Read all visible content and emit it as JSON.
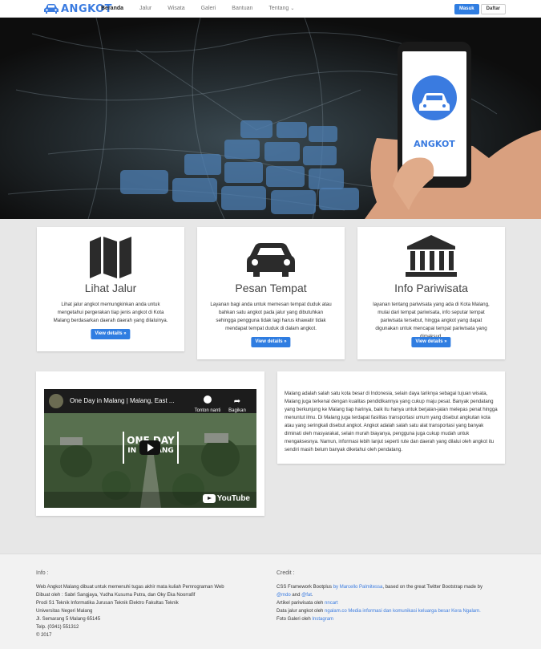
{
  "navbar": {
    "brand": "ANGKOT",
    "links": [
      "Beranda",
      "Jalur",
      "Wisata",
      "Galeri",
      "Bantuan",
      "Tentang"
    ],
    "active": "Beranda",
    "login": "Masuk",
    "register": "Daftar"
  },
  "hero": {
    "phone_brand": "ANGKOT"
  },
  "features": [
    {
      "icon": "map-icon",
      "title": "Lihat Jalur",
      "text": "Lihat jalur angkot memungkinkan anda untuk mengetahui pergerakan tiap jenis angkot di Kota Malang berdasarkan daerah daerah yang dilaluinya.",
      "button": "View details »"
    },
    {
      "icon": "car-icon",
      "title": "Pesan Tempat",
      "text": "Layanan bagi anda untuk memesan tempat duduk atau bahkan satu angkot pada jalur yang dibutuhkan sehingga pengguna tidak lagi harus khawatir tidak mendapat tempat duduk di dalam angkot.",
      "button": "View details »"
    },
    {
      "icon": "bank-icon",
      "title": "Info Pariwisata",
      "text": "layanan tentang pariwisata yang ada di Kota Malang, mulai dari tempat pariwisata, info seputar tempat pariwisata tersebut, hingga angkot yang dapat digunakan untuk mencapai tempat pariwisata yang dimaksud.",
      "button": "View details »"
    }
  ],
  "video": {
    "title": "One Day in Malang | Malang, East ...",
    "watch_later": "Tonton nanti",
    "share": "Bagikan",
    "overlay_line1": "ONE DAY",
    "overlay_line2": "IN MALANG",
    "youtube": "YouTube"
  },
  "about_text": "Malang adalah salah satu kota besar di Indonesia, selain daya tariknya sebagai tujuan wisata, Malang juga terkenal dengan kualitas pendidikannya yang cukup maju pesat. Banyak pendatang yang berkunjung ke Malang tiap harinya, baik itu hanya untuk berjalan-jalan melepas penat hingga menuntut ilmu. Di Malang juga terdapat fasilitas transportasi umum yang disebut angkutan kota atau yang seringkali disebut angkot. Angkot adalah salah satu alat transportasi yang banyak diminati oleh masyarakat, selain murah biayanya, pengguna juga cukup mudah untuk mengaksesnya. Namun, informasi lebih lanjut seperti rute dan daerah yang dilalui oleh angkot itu sendiri masih belum banyak diketahui oleh pendatang.",
  "footer": {
    "info_title": "Info :",
    "info_lines": [
      "Web Angkot Malang dibuat untuk memenuhi tugas akhir mata kuliah Pemrograman Web",
      "Dibuat oleh : Sabri Sangjaya, Yudha Kusuma Putra, dan Oky Eka Noorrafif",
      "Prodi S1 Teknik Informatika Jurusan Teknik Elektro Fakultas Teknik",
      "Universitas Negeri Malang",
      "Jl. Semarang 5 Malang 65145",
      "Telp. (0341) 551312",
      "© 2017"
    ],
    "credit_title": "Credit :",
    "credit": {
      "l1_pre": "CSS Framework Bootplus ",
      "l1_link": "by Marcello Palmitessa",
      "l1_post": ", based on the great Twitter Bootstrap made by",
      "l2_link1": "@mdo",
      "l2_mid": " and ",
      "l2_link2": "@fat",
      "l2_post": ".",
      "l3_pre": "Artikel pariwisata oleh ",
      "l3_link": "nncart",
      "l4_pre": "Data jalur angkot oleh ",
      "l4_link": "ngalam.co Media informasi dan komunikasi keluarga besar Kera Ngalam.",
      "l5_pre": "Foto Galeri oleh ",
      "l5_link": "Instagram"
    }
  },
  "colors": {
    "accent": "#2f7de1",
    "brand": "#3a7be0",
    "page_bg": "#e7e7e7"
  }
}
